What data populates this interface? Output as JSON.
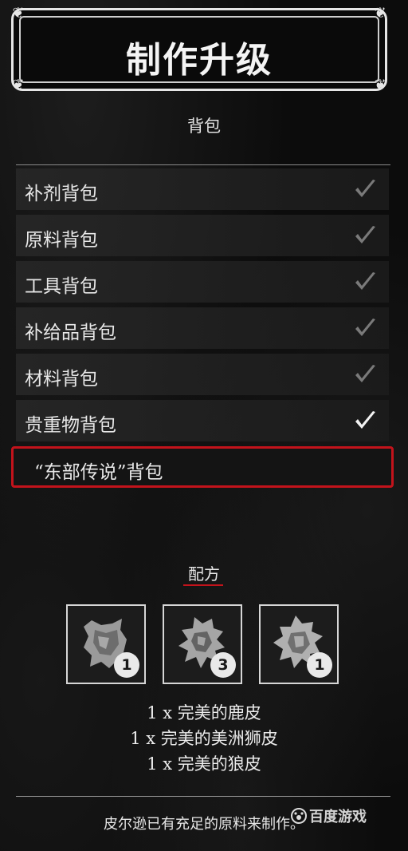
{
  "title": "制作升级",
  "bags_section": {
    "label": "背包",
    "items": [
      {
        "label": "补剂背包",
        "status": "crafted"
      },
      {
        "label": "原料背包",
        "status": "crafted"
      },
      {
        "label": "工具背包",
        "status": "crafted"
      },
      {
        "label": "补给品背包",
        "status": "crafted"
      },
      {
        "label": "材料背包",
        "status": "crafted"
      },
      {
        "label": "贵重物背包",
        "status": "available"
      },
      {
        "label": "“东部传说”背包",
        "status": "selected"
      }
    ]
  },
  "recipe": {
    "label": "配方",
    "ingredients": [
      {
        "icon": "deer-pelt-icon",
        "count": "1",
        "line": "1 x 完美的鹿皮"
      },
      {
        "icon": "cougar-pelt-icon",
        "count": "3",
        "line": "1 x 完美的美洲狮皮"
      },
      {
        "icon": "wolf-pelt-icon",
        "count": "1",
        "line": "1 x 完美的狼皮"
      }
    ]
  },
  "footer": {
    "message": "皮尔逊已有充足的原料来制作。"
  },
  "watermark": {
    "text": "百度游戏"
  },
  "colors": {
    "accent_red": "#c3131b",
    "check_dim": "#7a7a7a",
    "check_bright": "#f2f2f2"
  }
}
